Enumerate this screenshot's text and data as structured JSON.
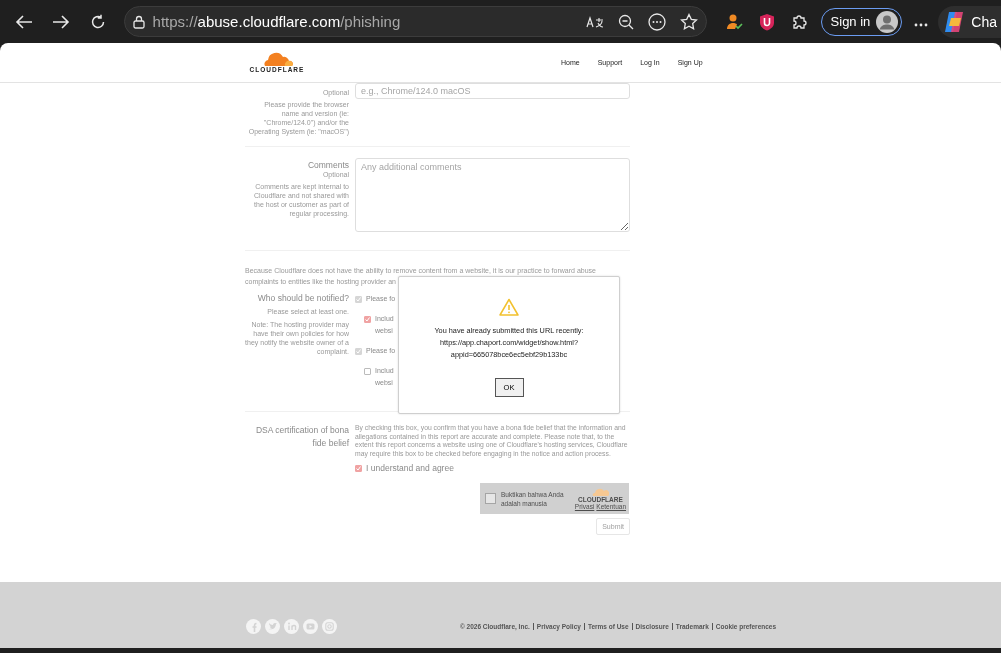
{
  "browser": {
    "scheme": "https://",
    "host": "abuse.cloudflare.com",
    "path": "/phishing",
    "sign_in": "Sign in",
    "side_label": "Cha"
  },
  "header": {
    "logo_text": "CLOUDFLARE",
    "nav": [
      "Home",
      "Support",
      "Log In",
      "Sign Up"
    ]
  },
  "browser_row": {
    "placeholder": "e.g., Chrome/124.0 macOS",
    "optional": "Optional",
    "help": "Please provide the browser name and version (ie: \"Chrome/124.0\") and/or the Operating System (ie: \"macOS\")"
  },
  "comments": {
    "label": "Comments",
    "optional": "Optional",
    "help": "Comments are kept internal to Cloudflare and not shared with the host or customer as part of regular processing.",
    "placeholder": "Any additional comments"
  },
  "notice": [
    "Because Cloudflare does not have the ability to remove content from a website, it is our practice to forward abuse",
    "complaints to entities like the hosting provider an"
  ],
  "notify": {
    "label": "Who should be notified?",
    "hint": "Please select at least one.",
    "note": "Note: The hosting provider may have their own policies for how they notify the website owner of a complaint.",
    "options": [
      {
        "kind": "main",
        "lines": [
          "Please fo"
        ],
        "checked": true,
        "disabled": true
      },
      {
        "kind": "sub",
        "lines": [
          "Includ",
          "websi"
        ],
        "checked": true,
        "disabled": false
      },
      {
        "kind": "main",
        "lines": [
          "Please fo"
        ],
        "checked": true,
        "disabled": true
      },
      {
        "kind": "sub",
        "lines": [
          "Includ",
          "websi"
        ],
        "checked": false,
        "disabled": false
      }
    ]
  },
  "dsa": {
    "label": "DSA certification of bona fide belief",
    "text": "By checking this box, you confirm that you have a bona fide belief that the information and allegations contained in this report are accurate and complete. Please note that, to the extent this report concerns a website using one of Cloudflare's hosting services, Cloudflare may require this box to be checked before engaging in the notice and action process.",
    "agree": "I understand and agree",
    "checked": true
  },
  "captcha": {
    "label": "Buktikan bahwa Anda adalah manusia",
    "checked": false,
    "brand": "CLOUDFLARE",
    "links": [
      "Privasi",
      "Ketentuan"
    ]
  },
  "submit": "Submit",
  "footer": {
    "copyright": "© 2026 Cloudflare, Inc.",
    "links": [
      "Privacy Policy",
      "Terms of Use",
      "Disclosure",
      "Trademark",
      "Cookie preferences"
    ]
  },
  "dialog": {
    "lines": [
      "You have already submitted this URL recently:",
      "https://app.chaport.com/widget/show.html?",
      "appid=665078bce6ec5ebf29b133bc"
    ],
    "button": "OK"
  }
}
